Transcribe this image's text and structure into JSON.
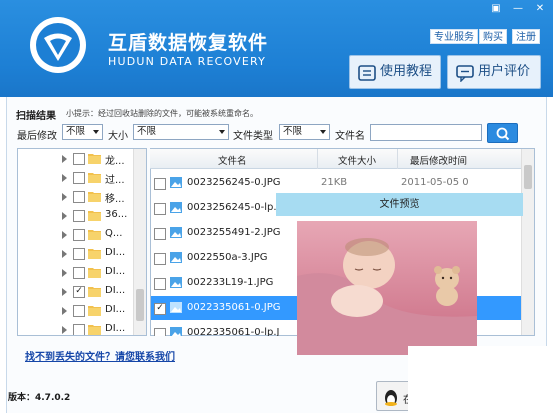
{
  "app": {
    "title": "互盾数据恢复软件",
    "subtitle": "HUDUN DATA RECOVERY",
    "version_label": "版本：4.7.0.2"
  },
  "window_controls": [
    "▣",
    "—",
    "✕"
  ],
  "header_links": [
    "专业服务",
    "购买",
    "注册"
  ],
  "header_buttons": [
    "使用教程",
    "用户评价"
  ],
  "scan": {
    "title": "扫描结果",
    "tip": "小提示：经过回收站删除的文件，可能被系统重命名。"
  },
  "filters": {
    "modified_label": "最后修改",
    "modified_value": "不限",
    "size_label": "大小",
    "size_value": "不限",
    "type_label": "文件类型",
    "type_value": "不限",
    "name_label": "文件名",
    "name_value": ""
  },
  "tree": [
    {
      "label": "龙...",
      "checked": false
    },
    {
      "label": "过...",
      "checked": false
    },
    {
      "label": "移...",
      "checked": false
    },
    {
      "label": "36...",
      "checked": false
    },
    {
      "label": "Q...",
      "checked": false
    },
    {
      "label": "DI...",
      "checked": false
    },
    {
      "label": "DI...",
      "checked": false
    },
    {
      "label": "DI...",
      "checked": true
    },
    {
      "label": "DI...",
      "checked": false
    },
    {
      "label": "DI...",
      "checked": false
    }
  ],
  "file_list": {
    "columns": [
      "文件名",
      "文件大小",
      "最后修改时间"
    ],
    "rows": [
      {
        "name": "0023256245-0.JPG",
        "size": "21KB",
        "date": "2011-05-05 0",
        "checked": false
      },
      {
        "name": "0023256245-0-lp.J",
        "size": "",
        "date": "",
        "checked": false
      },
      {
        "name": "0023255491-2.JPG",
        "size": "",
        "date": "",
        "checked": false
      },
      {
        "name": "0022550a-3.JPG",
        "size": "",
        "date": "",
        "checked": false
      },
      {
        "name": "002233L19-1.JPG",
        "size": "",
        "date": "",
        "checked": false
      },
      {
        "name": "0022335061-0.JPG",
        "size": "",
        "date": "",
        "checked": true
      },
      {
        "name": "0022335061-0-lp.J",
        "size": "",
        "date": "",
        "checked": false
      }
    ]
  },
  "preview": {
    "title": "文件预览"
  },
  "help_link": "找不到丢失的文件？请您联系我们",
  "bottom_button_label": "在",
  "colors": {
    "titlebar": "#1d7fd4",
    "accent": "#2c8be0",
    "link": "#1546a8",
    "selected_row": "#3399ff",
    "preview_header": "#a7dcf2"
  }
}
